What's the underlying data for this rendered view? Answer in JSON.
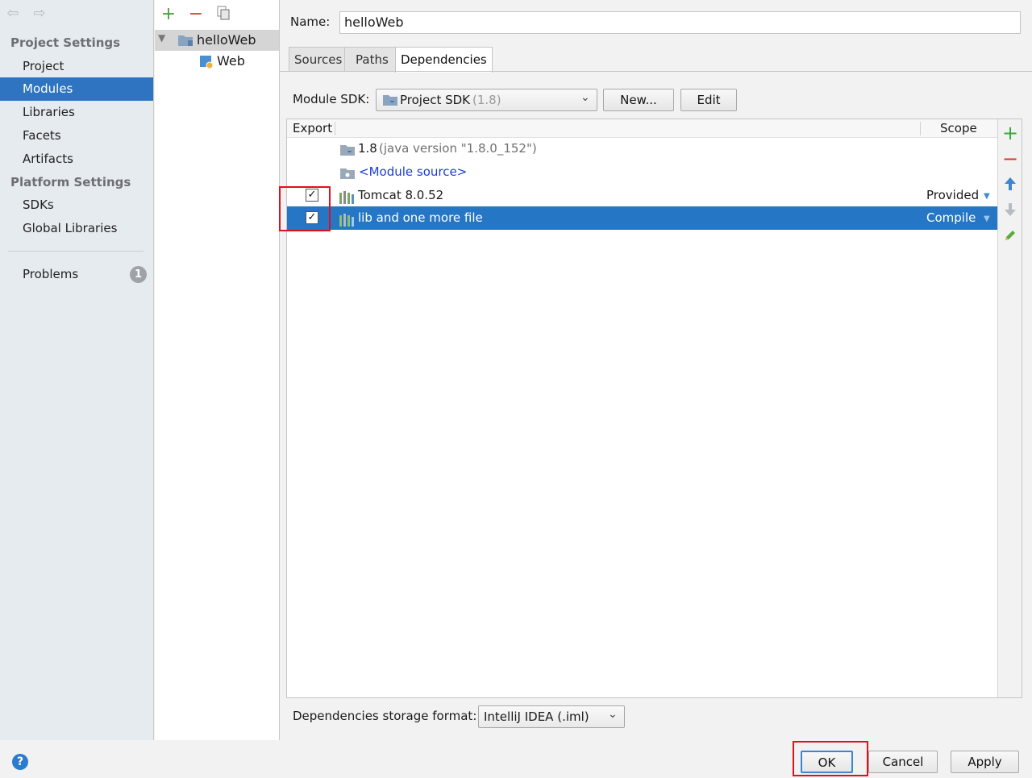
{
  "sidebar": {
    "back_icon": "back-arrow-icon",
    "forward_icon": "forward-arrow-icon",
    "project_settings_heading": "Project Settings",
    "project_items": [
      {
        "label": "Project"
      },
      {
        "label": "Modules",
        "selected": true
      },
      {
        "label": "Libraries"
      },
      {
        "label": "Facets"
      },
      {
        "label": "Artifacts"
      }
    ],
    "platform_settings_heading": "Platform Settings",
    "platform_items": [
      {
        "label": "SDKs"
      },
      {
        "label": "Global Libraries"
      }
    ],
    "problems": {
      "label": "Problems",
      "count": "1"
    }
  },
  "module_tree": {
    "toolbar": {
      "add_icon": "plus-icon",
      "remove_icon": "minus-icon",
      "copy_icon": "copy-icon"
    },
    "root": {
      "label": "helloWeb",
      "expanded": true
    },
    "children": [
      {
        "label": "Web"
      }
    ]
  },
  "module": {
    "name_label": "Name:",
    "name_value": "helloWeb",
    "tabs": [
      {
        "label": "Sources"
      },
      {
        "label": "Paths"
      },
      {
        "label": "Dependencies",
        "active": true
      }
    ],
    "sdk_label": "Module SDK:",
    "sdk_value": "Project SDK",
    "sdk_version": "(1.8)",
    "new_button": "New...",
    "edit_button": "Edit",
    "dependencies": {
      "col_export": "Export",
      "col_scope": "Scope",
      "rows": [
        {
          "checkbox": false,
          "icon": "jdk-folder-icon",
          "name": "1.8",
          "detail": "(java version \"1.8.0_152\")",
          "scope": ""
        },
        {
          "checkbox": false,
          "icon": "module-source-folder-icon",
          "name": "<Module source>",
          "detail": "",
          "scope": ""
        },
        {
          "checkbox": true,
          "checked": true,
          "icon": "library-icon",
          "name": "Tomcat 8.0.52",
          "detail": "",
          "scope": "Provided"
        },
        {
          "checkbox": true,
          "checked": true,
          "icon": "library-icon",
          "name": "lib and one more file",
          "detail": "",
          "scope": "Compile",
          "selected": true
        }
      ],
      "actions": [
        "add-icon",
        "remove-icon",
        "move-up-icon",
        "move-down-icon",
        "edit-pencil-icon"
      ]
    },
    "storage_label": "Dependencies storage format:",
    "storage_value": "IntelliJ IDEA (.iml)"
  },
  "footer": {
    "help_icon": "help-icon",
    "ok": "OK",
    "cancel": "Cancel",
    "apply": "Apply"
  },
  "colors": {
    "selection": "#2576c4",
    "sidebar_selection": "#2f74c0",
    "highlight_box": "#e0101c",
    "link": "#1a3fd6"
  }
}
